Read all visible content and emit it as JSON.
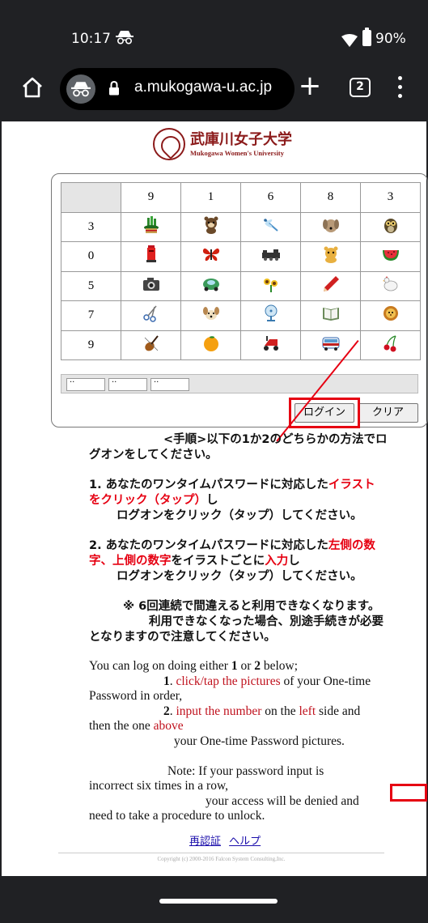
{
  "status_bar": {
    "time": "10:17",
    "battery": "90%"
  },
  "toolbar": {
    "url": "a.mukogawa-u.ac.jp",
    "tab_count": "2"
  },
  "logo": {
    "name_jp": "武庫川女子大学",
    "name_en": "Mukogawa Women's University"
  },
  "grid": {
    "column_headers": [
      "9",
      "1",
      "6",
      "8",
      "3"
    ],
    "row_headers": [
      "3",
      "0",
      "5",
      "7",
      "9"
    ],
    "pictures": [
      [
        "kadomatsu",
        "tanuki",
        "dragonfly",
        "dog",
        "owl"
      ],
      [
        "mailbox",
        "butterfly",
        "train",
        "bear",
        "watermelon"
      ],
      [
        "camera",
        "car",
        "sunflower",
        "pencil",
        "hen"
      ],
      [
        "scissors",
        "puppy",
        "fan",
        "book",
        "lion"
      ],
      [
        "violin",
        "orange",
        "scooter",
        "bus",
        "cherry"
      ]
    ],
    "password_fields": [
      "··",
      "··",
      "··"
    ]
  },
  "buttons": {
    "login": "ログイン",
    "clear": "クリア"
  },
  "instructions_jp": {
    "line1": "<手順>以下の1か2のどちらかの方法でロ",
    "line2": "グオンをしてください。",
    "step1_a": "1. あなたのワンタイムパスワードに対応した",
    "step1_a_red": "イラスト",
    "step1_b_red": "をクリック（タップ）",
    "step1_b": "し",
    "step1_c": "ログオンをクリック（タップ）してください。",
    "step2_a": "2. あなたのワンタイムパスワードに対応した",
    "step2_a_red": "左側の数",
    "step2_b_red": "字、上側の数字",
    "step2_b": "をイラストごとに",
    "step2_b_red2": "入力",
    "step2_b2": "し",
    "step2_c": "ログオンをクリック（タップ）してください。",
    "note1": "※ 6回連続で間違えると利用できなくなります。",
    "note2": "利用できなくなった場合、別途手続きが必要",
    "note3": "となりますので注意してください。"
  },
  "instructions_en": {
    "l1a": "You can log on doing either ",
    "l1b": "1",
    "l1c": " or ",
    "l1d": "2",
    "l1e": " below;",
    "l2a": "1",
    "l2b": ". ",
    "l2c": "click/tap the pictures",
    "l2d": " of your One-time",
    "l3": "Password in order,",
    "l4a": "2",
    "l4b": ". ",
    "l4c": "input the number",
    "l4d": " on the ",
    "l4e": "left",
    "l4f": " side and",
    "l5a": "then the one ",
    "l5b": "above",
    "l6": "your One-time Password pictures.",
    "l7": "Note:   If your password input is",
    "l8": "incorrect six times in a row,",
    "l9": "your access will be denied and",
    "l10": "need to take a procedure to unlock."
  },
  "links": {
    "reauth": "再認証",
    "help": "ヘルプ"
  },
  "copyright": "Copyright (c) 2000-2016 Falcon System Consulting,Inc.",
  "colors": {
    "accent_red": "#e60012",
    "logo_red": "#8b1a1a",
    "chrome_dark": "#202124"
  }
}
